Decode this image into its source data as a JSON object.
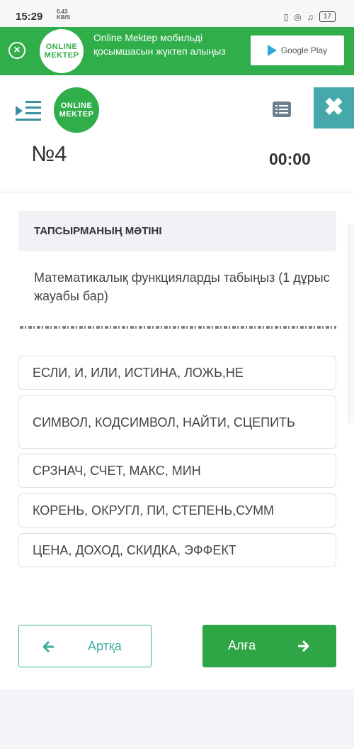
{
  "status_bar": {
    "time": "15:29",
    "net_speed": "0.43",
    "net_unit": "KB/S",
    "battery": "17"
  },
  "banner": {
    "logo_line1": "ONLINE",
    "logo_line2": "MEKTEP",
    "message": "Online Mektep мобильді қосымшасын жүктеп алыңыз",
    "store_label": "Google Play"
  },
  "header": {
    "logo_line1": "ONLINE",
    "logo_line2": "MEKTEP",
    "close_symbol": "✖"
  },
  "question": {
    "number": "№4",
    "timer": "00:00",
    "section_title": "ТАПСЫРМАНЫҢ МӘТІНІ",
    "text": "Математикалық функцияларды табыңыз (1 дұрыс жауабы бар)"
  },
  "options": [
    "ЕСЛИ, И, ИЛИ, ИСТИНА, ЛОЖЬ,НЕ",
    "СИМВОЛ, КОДСИМВОЛ, НАЙТИ, СЦЕПИТЬ",
    "СРЗНАЧ, СЧЕТ, МАКС, МИН",
    "КОРЕНЬ, ОКРУГЛ, ПИ, СТЕПЕНЬ,СУММ",
    "ЦЕНА, ДОХОД, СКИДКА, ЭФФЕКТ"
  ],
  "nav": {
    "back_label": "Артқа",
    "next_label": "Алға"
  },
  "colors": {
    "brand_green": "#2fae4a",
    "accent_teal": "#47a8ab",
    "back_text": "#3fae9f"
  },
  "icons": [
    "close-circle-icon",
    "google-play-icon",
    "menu-icon",
    "list-icon",
    "close-icon",
    "arrow-left-icon",
    "arrow-right-icon"
  ]
}
